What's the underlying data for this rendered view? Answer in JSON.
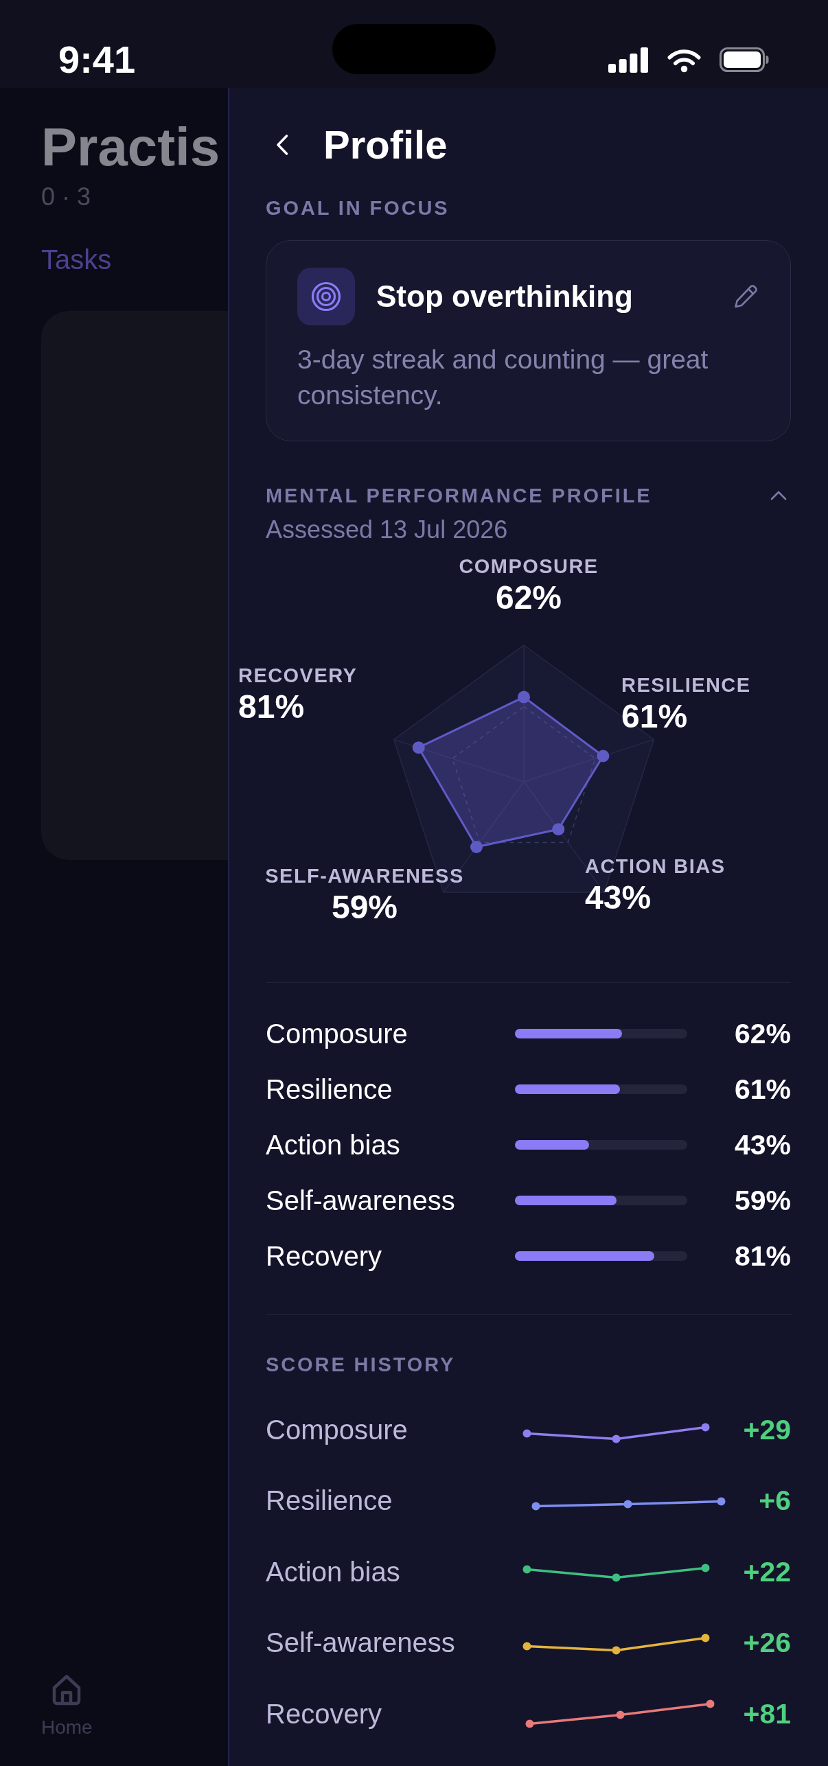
{
  "status_bar": {
    "time": "9:41"
  },
  "background_screen": {
    "title": "Practis",
    "count": "0 · 3",
    "tab": "Tasks",
    "tab_bar": [
      {
        "label": "Home"
      }
    ]
  },
  "profile_panel": {
    "title": "Profile",
    "goal_section": {
      "heading": "GOAL IN FOCUS",
      "goal": {
        "title": "Stop overthinking",
        "note": "3-day streak and counting — great consistency."
      }
    },
    "performance": {
      "heading": "MENTAL PERFORMANCE PROFILE",
      "expanded": true,
      "assessed": "Assessed 13 Jul 2026",
      "radar_labels": [
        {
          "label": "COMPOSURE",
          "reading": "62%"
        },
        {
          "label": "RECOVERY",
          "reading": "81%"
        },
        {
          "label": "RESILIENCE",
          "reading": "61%"
        },
        {
          "label": "SELF-AWARENESS",
          "reading": "59%"
        },
        {
          "label": "ACTION BIAS",
          "reading": "43%"
        }
      ],
      "scores": [
        {
          "name": "Composure",
          "level": 0.62,
          "reading": "62%"
        },
        {
          "name": "Resilience",
          "level": 0.61,
          "reading": "61%"
        },
        {
          "name": "Action bias",
          "level": 0.43,
          "reading": "43%"
        },
        {
          "name": "Self-awareness",
          "level": 0.59,
          "reading": "59%"
        },
        {
          "name": "Recovery",
          "level": 0.81,
          "reading": "81%"
        }
      ]
    },
    "history": {
      "heading": "SCORE HISTORY",
      "rows": [
        {
          "name": "Composure",
          "color": "#8f7ef0",
          "change": "+29"
        },
        {
          "name": "Resilience",
          "color": "#7e8ff0",
          "change": "+6"
        },
        {
          "name": "Action bias",
          "color": "#3fbf80",
          "change": "+22"
        },
        {
          "name": "Self-awareness",
          "color": "#e5b43c",
          "change": "+26"
        },
        {
          "name": "Recovery",
          "color": "#e87a7a",
          "change": "+81"
        }
      ]
    }
  }
}
